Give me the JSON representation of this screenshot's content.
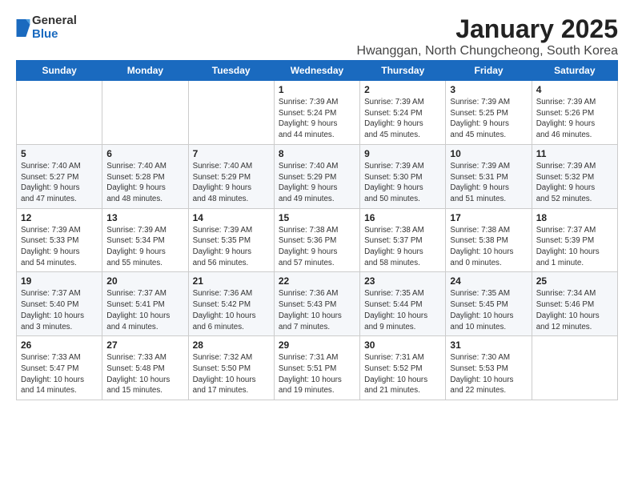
{
  "logo": {
    "general": "General",
    "blue": "Blue"
  },
  "title": "January 2025",
  "subtitle": "Hwanggan, North Chungcheong, South Korea",
  "weekdays": [
    "Sunday",
    "Monday",
    "Tuesday",
    "Wednesday",
    "Thursday",
    "Friday",
    "Saturday"
  ],
  "weeks": [
    [
      {
        "day": "",
        "info": ""
      },
      {
        "day": "",
        "info": ""
      },
      {
        "day": "",
        "info": ""
      },
      {
        "day": "1",
        "info": "Sunrise: 7:39 AM\nSunset: 5:24 PM\nDaylight: 9 hours\nand 44 minutes."
      },
      {
        "day": "2",
        "info": "Sunrise: 7:39 AM\nSunset: 5:24 PM\nDaylight: 9 hours\nand 45 minutes."
      },
      {
        "day": "3",
        "info": "Sunrise: 7:39 AM\nSunset: 5:25 PM\nDaylight: 9 hours\nand 45 minutes."
      },
      {
        "day": "4",
        "info": "Sunrise: 7:39 AM\nSunset: 5:26 PM\nDaylight: 9 hours\nand 46 minutes."
      }
    ],
    [
      {
        "day": "5",
        "info": "Sunrise: 7:40 AM\nSunset: 5:27 PM\nDaylight: 9 hours\nand 47 minutes."
      },
      {
        "day": "6",
        "info": "Sunrise: 7:40 AM\nSunset: 5:28 PM\nDaylight: 9 hours\nand 48 minutes."
      },
      {
        "day": "7",
        "info": "Sunrise: 7:40 AM\nSunset: 5:29 PM\nDaylight: 9 hours\nand 48 minutes."
      },
      {
        "day": "8",
        "info": "Sunrise: 7:40 AM\nSunset: 5:29 PM\nDaylight: 9 hours\nand 49 minutes."
      },
      {
        "day": "9",
        "info": "Sunrise: 7:39 AM\nSunset: 5:30 PM\nDaylight: 9 hours\nand 50 minutes."
      },
      {
        "day": "10",
        "info": "Sunrise: 7:39 AM\nSunset: 5:31 PM\nDaylight: 9 hours\nand 51 minutes."
      },
      {
        "day": "11",
        "info": "Sunrise: 7:39 AM\nSunset: 5:32 PM\nDaylight: 9 hours\nand 52 minutes."
      }
    ],
    [
      {
        "day": "12",
        "info": "Sunrise: 7:39 AM\nSunset: 5:33 PM\nDaylight: 9 hours\nand 54 minutes."
      },
      {
        "day": "13",
        "info": "Sunrise: 7:39 AM\nSunset: 5:34 PM\nDaylight: 9 hours\nand 55 minutes."
      },
      {
        "day": "14",
        "info": "Sunrise: 7:39 AM\nSunset: 5:35 PM\nDaylight: 9 hours\nand 56 minutes."
      },
      {
        "day": "15",
        "info": "Sunrise: 7:38 AM\nSunset: 5:36 PM\nDaylight: 9 hours\nand 57 minutes."
      },
      {
        "day": "16",
        "info": "Sunrise: 7:38 AM\nSunset: 5:37 PM\nDaylight: 9 hours\nand 58 minutes."
      },
      {
        "day": "17",
        "info": "Sunrise: 7:38 AM\nSunset: 5:38 PM\nDaylight: 10 hours\nand 0 minutes."
      },
      {
        "day": "18",
        "info": "Sunrise: 7:37 AM\nSunset: 5:39 PM\nDaylight: 10 hours\nand 1 minute."
      }
    ],
    [
      {
        "day": "19",
        "info": "Sunrise: 7:37 AM\nSunset: 5:40 PM\nDaylight: 10 hours\nand 3 minutes."
      },
      {
        "day": "20",
        "info": "Sunrise: 7:37 AM\nSunset: 5:41 PM\nDaylight: 10 hours\nand 4 minutes."
      },
      {
        "day": "21",
        "info": "Sunrise: 7:36 AM\nSunset: 5:42 PM\nDaylight: 10 hours\nand 6 minutes."
      },
      {
        "day": "22",
        "info": "Sunrise: 7:36 AM\nSunset: 5:43 PM\nDaylight: 10 hours\nand 7 minutes."
      },
      {
        "day": "23",
        "info": "Sunrise: 7:35 AM\nSunset: 5:44 PM\nDaylight: 10 hours\nand 9 minutes."
      },
      {
        "day": "24",
        "info": "Sunrise: 7:35 AM\nSunset: 5:45 PM\nDaylight: 10 hours\nand 10 minutes."
      },
      {
        "day": "25",
        "info": "Sunrise: 7:34 AM\nSunset: 5:46 PM\nDaylight: 10 hours\nand 12 minutes."
      }
    ],
    [
      {
        "day": "26",
        "info": "Sunrise: 7:33 AM\nSunset: 5:47 PM\nDaylight: 10 hours\nand 14 minutes."
      },
      {
        "day": "27",
        "info": "Sunrise: 7:33 AM\nSunset: 5:48 PM\nDaylight: 10 hours\nand 15 minutes."
      },
      {
        "day": "28",
        "info": "Sunrise: 7:32 AM\nSunset: 5:50 PM\nDaylight: 10 hours\nand 17 minutes."
      },
      {
        "day": "29",
        "info": "Sunrise: 7:31 AM\nSunset: 5:51 PM\nDaylight: 10 hours\nand 19 minutes."
      },
      {
        "day": "30",
        "info": "Sunrise: 7:31 AM\nSunset: 5:52 PM\nDaylight: 10 hours\nand 21 minutes."
      },
      {
        "day": "31",
        "info": "Sunrise: 7:30 AM\nSunset: 5:53 PM\nDaylight: 10 hours\nand 22 minutes."
      },
      {
        "day": "",
        "info": ""
      }
    ]
  ]
}
